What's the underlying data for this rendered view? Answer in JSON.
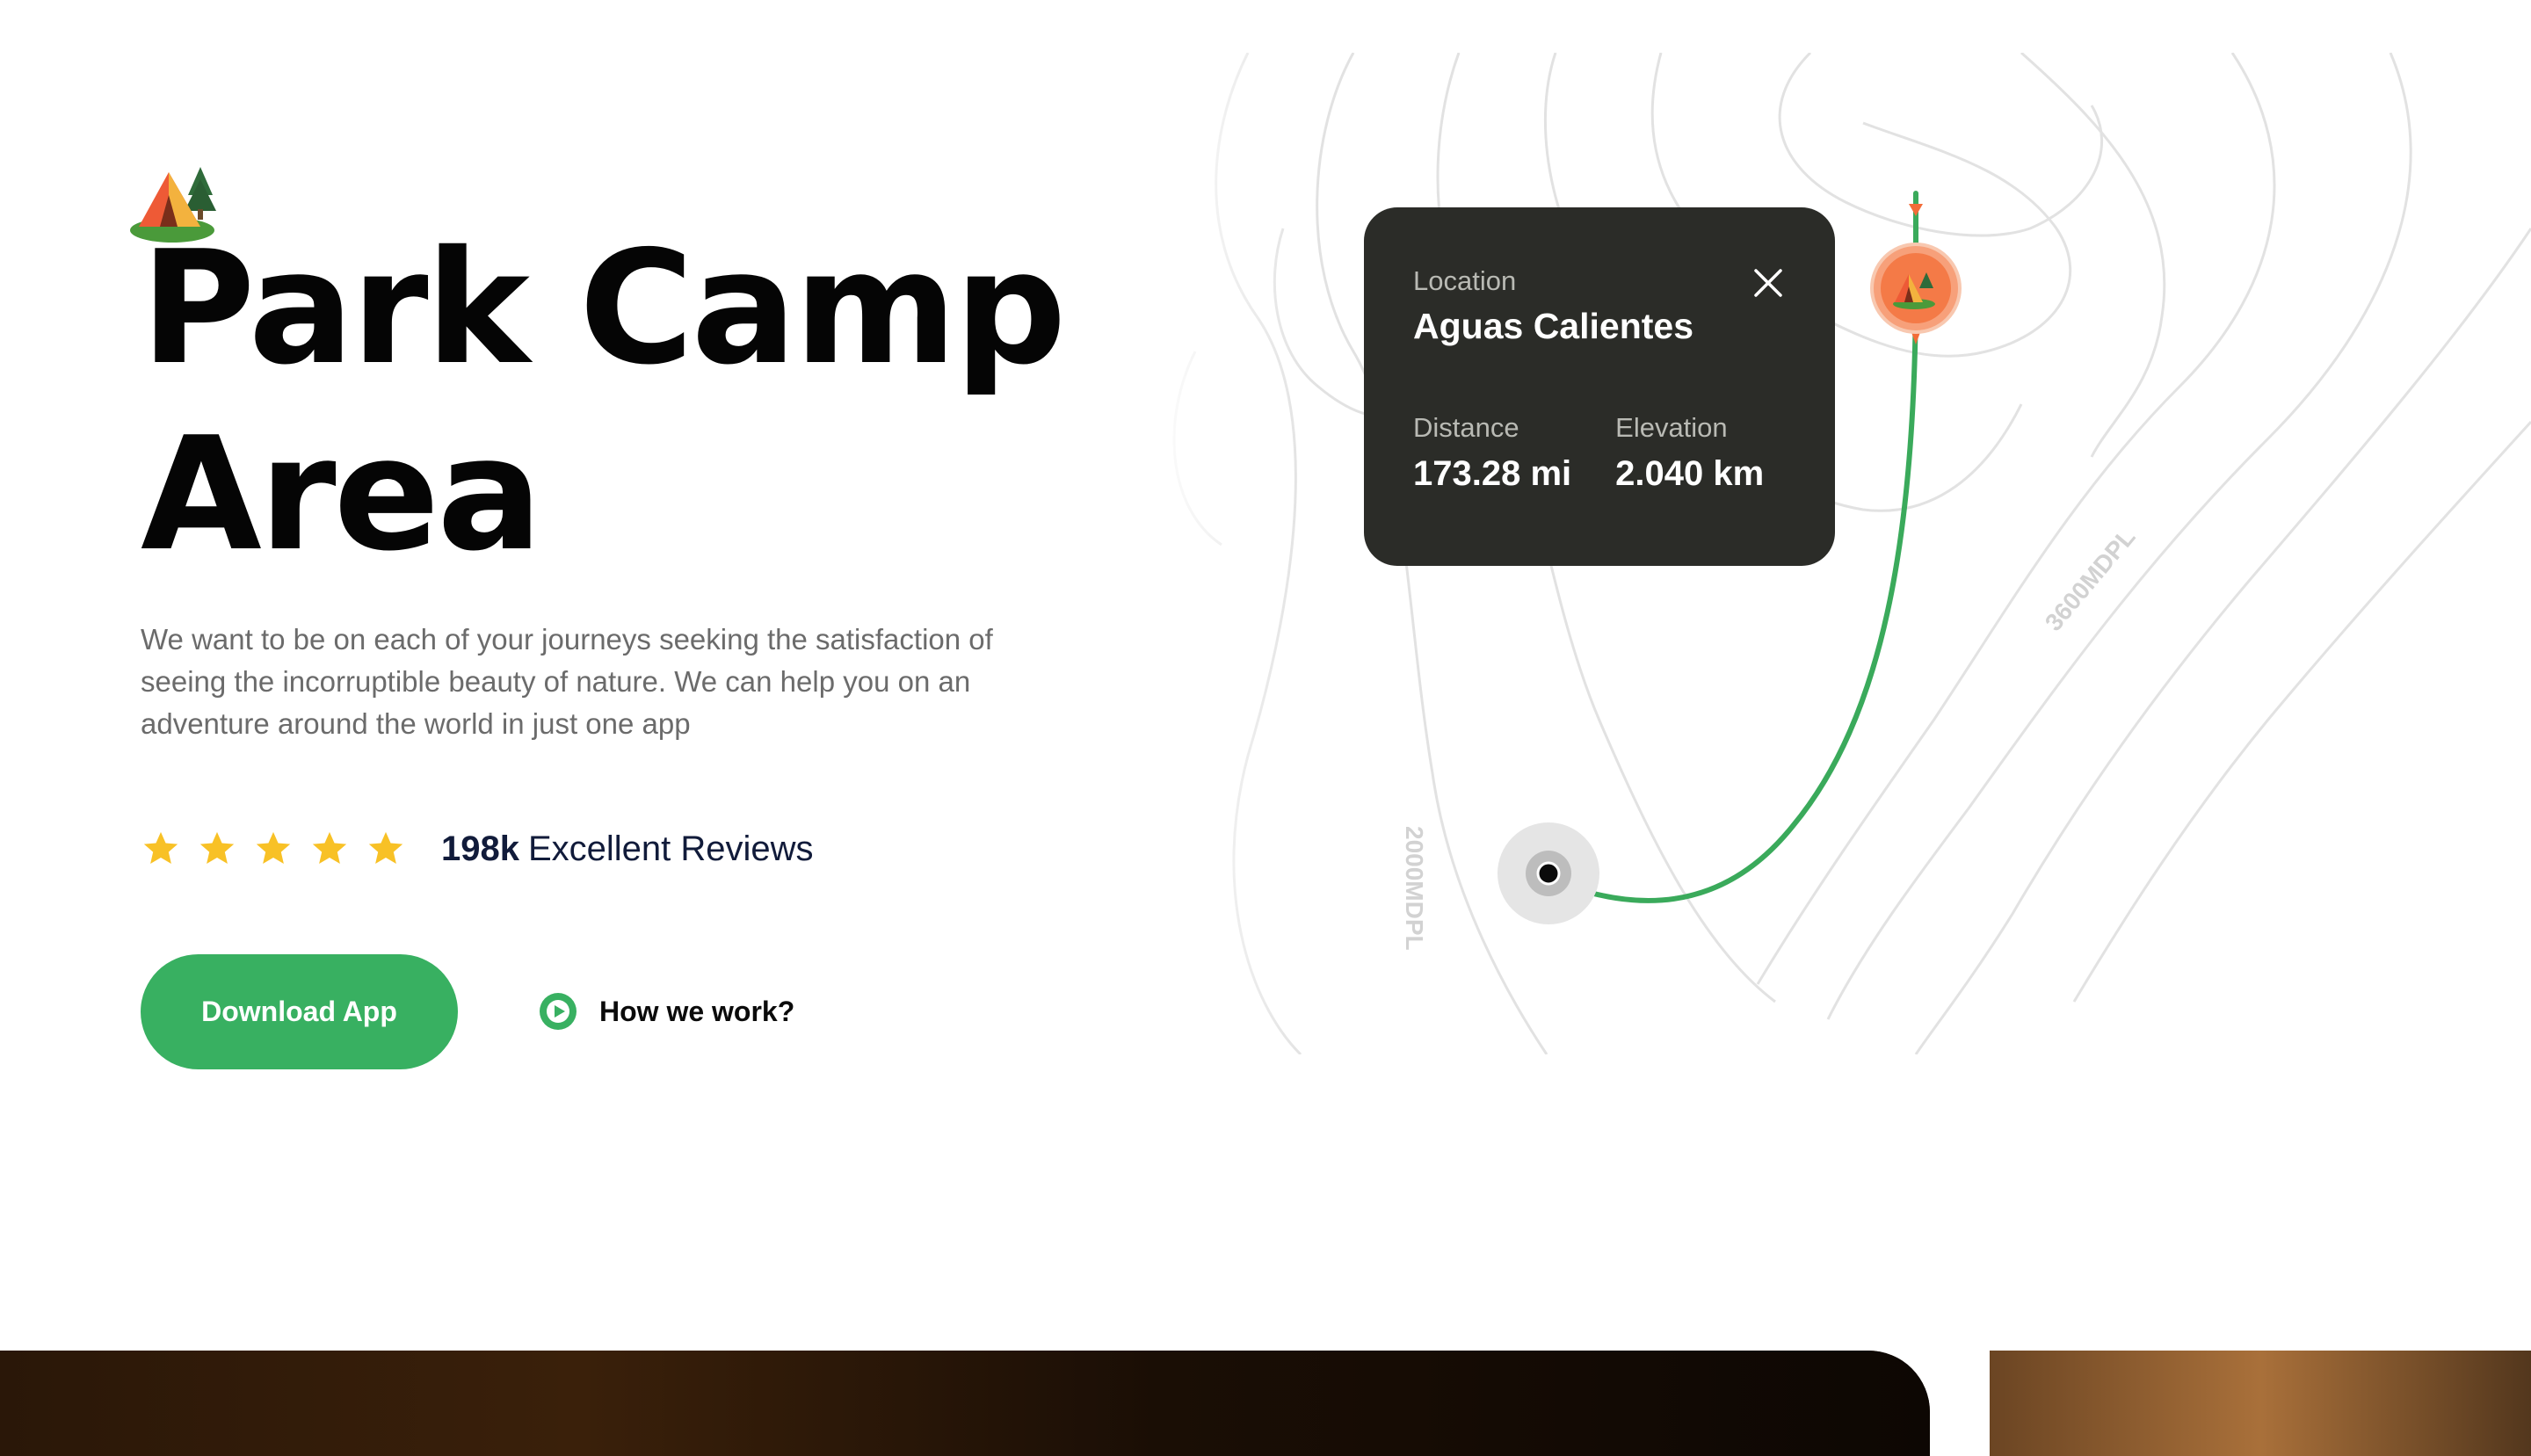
{
  "hero": {
    "title_line1": "Park Camp",
    "title_line2": "Area",
    "description": "We want to be on each of your journeys seeking the satisfaction of seeing the incorruptible beauty of nature. We can help you on an adventure around the world in just one app",
    "rating_stars": 5,
    "reviews_count": "198k",
    "reviews_label": "Excellent Reviews",
    "download_label": "Download App",
    "how_label": "How we work?"
  },
  "map": {
    "contour_label_1": "2000MDPL",
    "contour_label_2": "3600MDPL",
    "card": {
      "location_label": "Location",
      "location_value": "Aguas Calientes",
      "distance_label": "Distance",
      "distance_value": "173.28 mi",
      "elevation_label": "Elevation",
      "elevation_value": "2.040 km"
    }
  },
  "colors": {
    "accent_green": "#38b061",
    "star_yellow": "#f8c126",
    "card_bg": "#2b2c28",
    "pin_orange": "#f58b5c"
  },
  "icons": [
    "tent-icon",
    "star-icon",
    "play-icon",
    "close-icon",
    "location-pin-icon",
    "current-position-icon"
  ]
}
